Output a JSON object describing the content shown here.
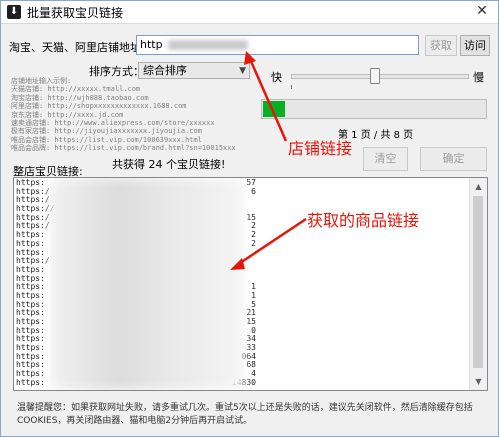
{
  "window": {
    "title": "批量获取宝贝链接",
    "icon": "download-icon",
    "close_label": "✕"
  },
  "store_url": {
    "label": "淘宝、天猫、阿里店铺地址：",
    "value_prefix": "http"
  },
  "buttons": {
    "fetch": "获取",
    "visit": "访问",
    "clear": "清空",
    "confirm": "确定"
  },
  "sort": {
    "label": "排序方式：",
    "selected": "综合排序"
  },
  "speed": {
    "fast": "快",
    "slow": "慢"
  },
  "help_lines": [
    "店铺地址输入示例:",
    "天猫店铺: http://xxxxx.tmall.com",
    "淘宝店铺: http://wjh888.taobao.com",
    "阿里店铺: http://shopxxxxxxxxxxxxx.1688.com",
    "京东店铺: http://xxxx.jd.com",
    "速卖通店铺: http://www.aliexpress.com/store/xxxxxx",
    "极有家店铺: http://jiyoujiaxxxxxxx.jiyoujia.com",
    "唯品会店铺: https://list.vip.com/100639xxx.html",
    "唯品会品牌: https://list.vip.com/brand.html?sn=10015xxx"
  ],
  "progress": {
    "fraction": 0.1,
    "page_text": "第 1 页 / 共 8 页"
  },
  "results": {
    "label": "整店宝贝链接:",
    "summary": "共获得 24 个宝贝链接!",
    "rows": [
      {
        "prefix": "https:",
        "suffix": "57"
      },
      {
        "prefix": "https:/",
        "suffix": "6"
      },
      {
        "prefix": "https:/",
        "suffix": ""
      },
      {
        "prefix": "https://",
        "suffix": ""
      },
      {
        "prefix": "https:/",
        "suffix": "15"
      },
      {
        "prefix": "https:/",
        "suffix": "2"
      },
      {
        "prefix": "https:",
        "suffix": "2"
      },
      {
        "prefix": "https:",
        "suffix": "2"
      },
      {
        "prefix": "https:",
        "suffix": ""
      },
      {
        "prefix": "https:/",
        "suffix": ""
      },
      {
        "prefix": "https:",
        "suffix": ""
      },
      {
        "prefix": "https:",
        "suffix": ""
      },
      {
        "prefix": "https:",
        "suffix": "1"
      },
      {
        "prefix": "https:",
        "suffix": "1"
      },
      {
        "prefix": "https:",
        "suffix": "5"
      },
      {
        "prefix": "https:",
        "suffix": "21"
      },
      {
        "prefix": "https:",
        "suffix": "15"
      },
      {
        "prefix": "https:",
        "suffix": "0"
      },
      {
        "prefix": "https:",
        "suffix": "34"
      },
      {
        "prefix": "https:",
        "suffix": "33"
      },
      {
        "prefix": "https:",
        "suffix": "064"
      },
      {
        "prefix": "https:",
        "suffix": "68"
      },
      {
        "prefix": "https:",
        "suffix": "4"
      },
      {
        "prefix": "https:",
        "suffix": "14830"
      }
    ]
  },
  "annotations": {
    "store_link": "店铺链接",
    "product_links": "获取的商品链接",
    "color": "#e8150a"
  },
  "footer": "温馨提醒您：如果获取网址失败，请多重试几次。重试5次以上还是失败的话，建议先关闭软件，然后清除缓存包括COOKIES，再关闭路由器、猫和电脑2分钟后再开启试试。",
  "colors": {
    "progress_fill": "#06b025",
    "input_border": "#7a9cd3"
  }
}
